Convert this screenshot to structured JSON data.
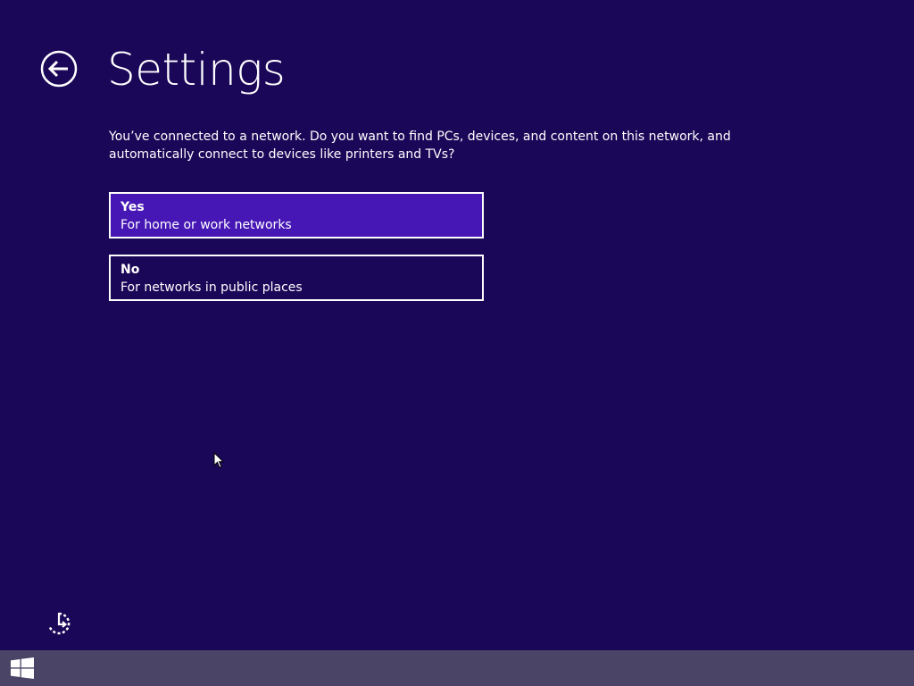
{
  "page": {
    "title": "Settings",
    "question": "You’ve connected to a network. Do you want to find PCs, devices, and content on this network, and automatically connect to devices like printers and TVs?"
  },
  "options": [
    {
      "title": "Yes",
      "description": "For home or work networks",
      "selected": true
    },
    {
      "title": "No",
      "description": "For networks in public places",
      "selected": false
    }
  ],
  "icons": {
    "back": "back-arrow-icon",
    "ease_of_access": "ease-of-access-icon",
    "start": "windows-logo-icon",
    "pointer": "mouse-pointer-icon"
  },
  "colors": {
    "background": "#1b0758",
    "selected_option": "#4617b4",
    "taskbar": "#4a4566",
    "text": "#ffffff"
  }
}
